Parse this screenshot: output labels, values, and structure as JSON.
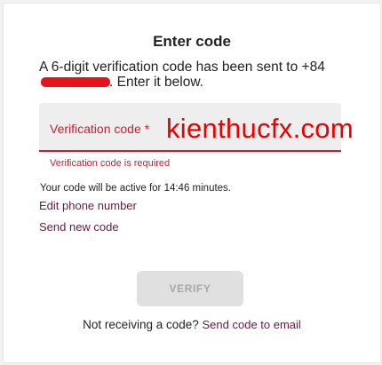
{
  "dialog": {
    "title": "Enter code",
    "description_prefix": "A 6-digit verification code has been sent to +84",
    "description_suffix": ". Enter it below."
  },
  "input": {
    "label": "Verification code *",
    "error": "Verification code is required"
  },
  "watermark": "kienthucfx.com",
  "status": {
    "active_text": "Your code will be active for 14:46 minutes."
  },
  "links": {
    "edit_phone": "Edit phone number",
    "send_new": "Send new code"
  },
  "buttons": {
    "verify": "VERIFY"
  },
  "footer": {
    "prompt": "Not receiving a code?",
    "email_link": "Send code to email"
  },
  "colors": {
    "accent": "#c91c33",
    "link": "#6b1746",
    "watermark": "#ea0000",
    "redaction": "#e8121a"
  }
}
